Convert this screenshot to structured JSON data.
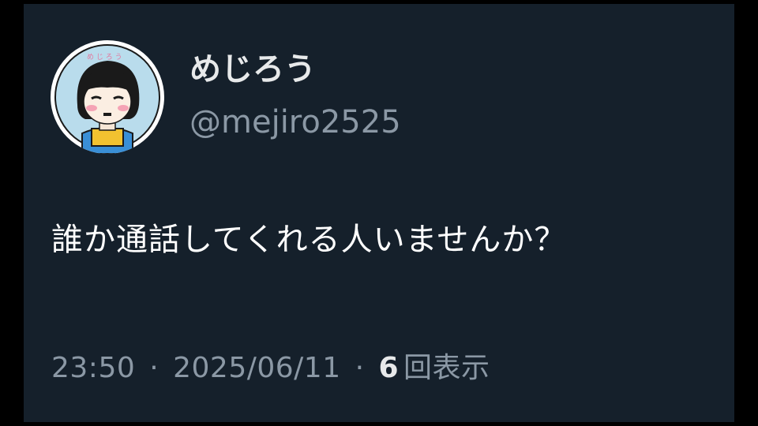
{
  "author": {
    "display_name": "めじろう",
    "handle": "@mejiro2525",
    "avatar_icon": "cartoon-avatar-icon"
  },
  "tweet": {
    "text": "誰か通話してくれる人いませんか？"
  },
  "meta": {
    "time": "23:50",
    "separator": "·",
    "date": "2025/06/11",
    "view_count": "6",
    "view_label": "回表示"
  },
  "colors": {
    "background": "#15202b",
    "outer": "#000000",
    "primary_text": "#e7e9ea",
    "secondary_text": "#8b98a5"
  }
}
